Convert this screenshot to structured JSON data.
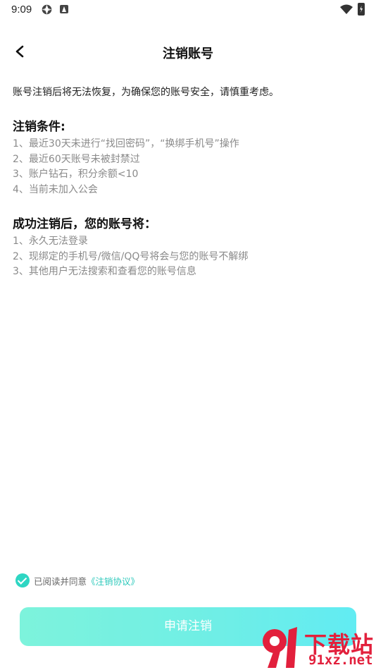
{
  "status_bar": {
    "time": "9:09"
  },
  "header": {
    "title": "注销账号"
  },
  "intro": "账号注销后将无法恢复，为确保您的账号安全，请慎重考虑。",
  "conditions": {
    "title": "注销条件:",
    "items": [
      "1、最近30天未进行“找回密码”，“换绑手机号”操作",
      "2、最近60天账号未被封禁过",
      "3、账户钻石，积分余额<10",
      "4、当前未加入公会"
    ]
  },
  "after": {
    "title": "成功注销后，您的账号将：",
    "items": [
      "1、永久无法登录",
      "2、现绑定的手机号/微信/QQ号将会与您的账号不解绑",
      "3、其他用户无法搜索和查看您的账号信息"
    ]
  },
  "agreement": {
    "checked": true,
    "text": "已阅读并同意",
    "link": "《注销协议》"
  },
  "submit_label": "申请注销",
  "watermark": {
    "line1": "下载站",
    "line2": "91xz.net"
  },
  "colors": {
    "accent": "#2ed6c3",
    "button_start": "#52efd0",
    "button_end": "#2de5ee",
    "watermark": "#e2203c"
  }
}
